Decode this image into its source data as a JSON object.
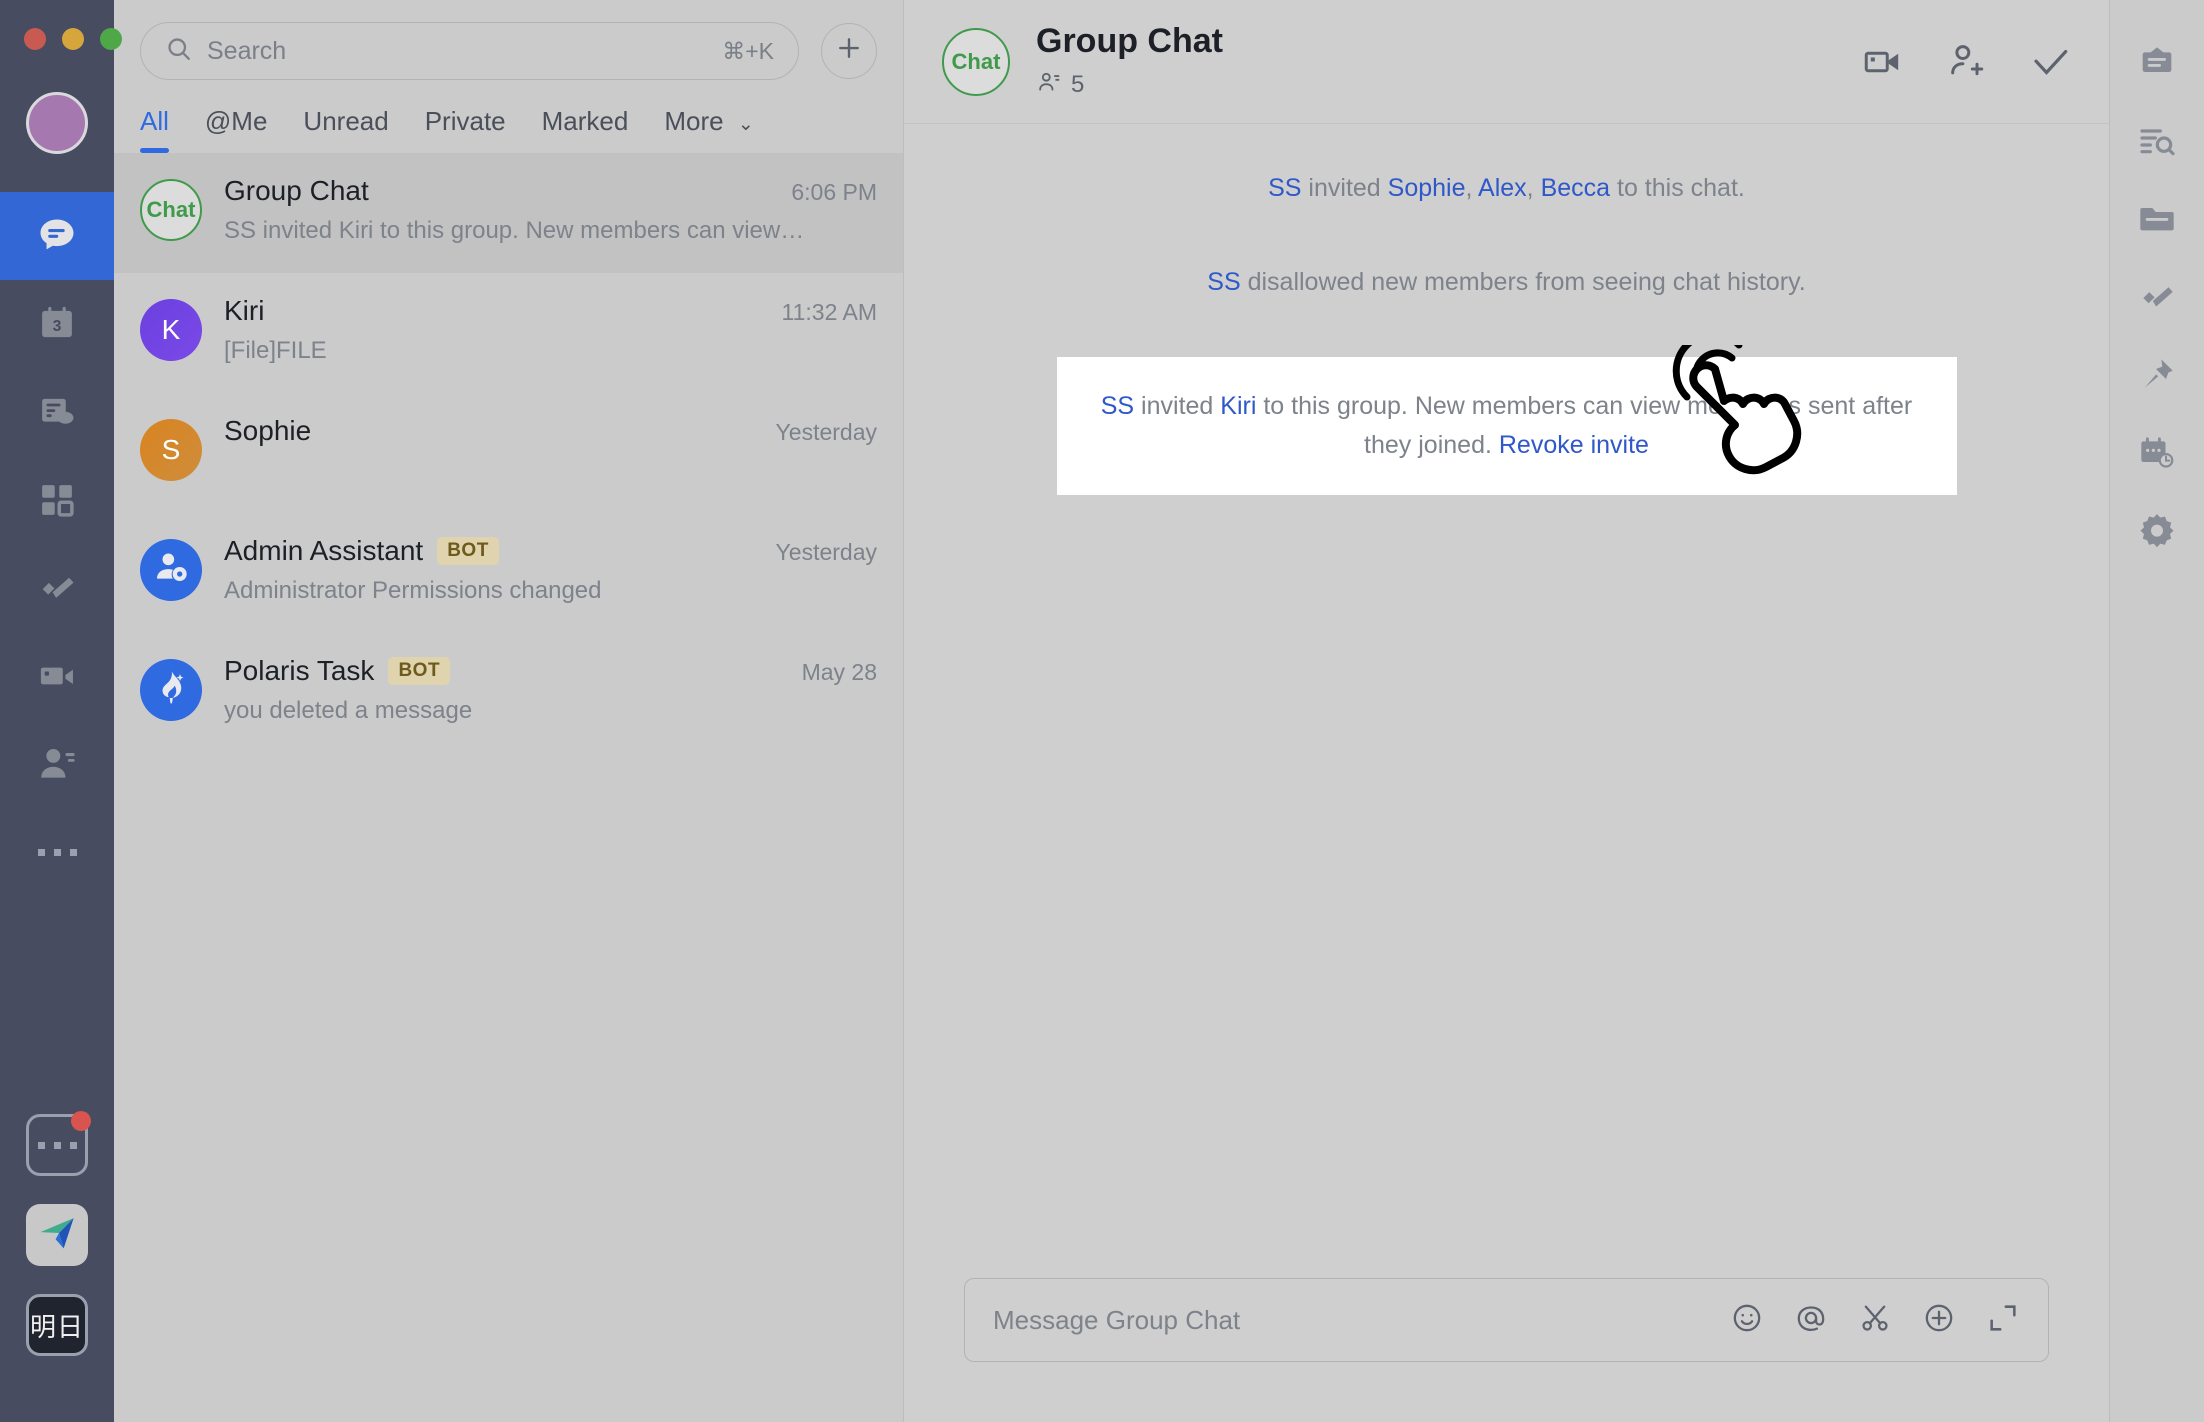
{
  "window": {
    "traffic_lights": [
      "close",
      "minimize",
      "maximize"
    ]
  },
  "left_rail": {
    "avatar_label": "",
    "items": [
      {
        "name": "chat",
        "icon": "chat-bubble-icon",
        "active": true
      },
      {
        "name": "calendar",
        "icon": "calendar-3-icon",
        "badge": "3",
        "active": false
      },
      {
        "name": "docs",
        "icon": "document-cloud-icon",
        "active": false
      },
      {
        "name": "workspace",
        "icon": "grid-apps-icon",
        "active": false
      },
      {
        "name": "tasks",
        "icon": "check-tasks-icon",
        "active": false
      },
      {
        "name": "meetings",
        "icon": "video-camera-icon",
        "active": false
      },
      {
        "name": "contacts",
        "icon": "contacts-icon",
        "active": false
      },
      {
        "name": "more",
        "icon": "ellipsis-icon",
        "active": false
      }
    ],
    "bottom": [
      {
        "name": "more-apps",
        "icon": "ellipsis-box-icon",
        "has_badge": true
      },
      {
        "name": "plane-app",
        "icon": "paper-plane-icon",
        "has_badge": false
      },
      {
        "name": "tomorrow-app",
        "icon": "kanji-icon",
        "label": "明日",
        "has_badge": false
      }
    ]
  },
  "search": {
    "placeholder": "Search",
    "shortcut": "⌘+K",
    "icon": "search-icon"
  },
  "new_chat_button": {
    "label": "+",
    "name": "new-chat-button"
  },
  "tabs": [
    {
      "label": "All",
      "active": true
    },
    {
      "label": "@Me",
      "active": false
    },
    {
      "label": "Unread",
      "active": false
    },
    {
      "label": "Private",
      "active": false
    },
    {
      "label": "Marked",
      "active": false
    },
    {
      "label": "More",
      "active": false,
      "chevron": "⌄"
    }
  ],
  "chat_list": [
    {
      "title": "Group Chat",
      "subtitle": "SS invited Kiri to this group. New members can view…",
      "time": "6:06 PM",
      "avatar_text": "Chat",
      "avatar_kind": "chat",
      "bot": false,
      "selected": true
    },
    {
      "title": "Kiri",
      "subtitle": "[File]FILE",
      "time": "11:32 AM",
      "avatar_text": "K",
      "avatar_kind": "kiri",
      "bot": false,
      "selected": false
    },
    {
      "title": "Sophie",
      "subtitle": "",
      "time": "Yesterday",
      "avatar_text": "S",
      "avatar_kind": "sophie",
      "bot": false,
      "selected": false
    },
    {
      "title": "Admin Assistant",
      "subtitle": "Administrator Permissions changed",
      "time": "Yesterday",
      "avatar_text": "",
      "avatar_kind": "bot-admin",
      "bot": true,
      "bot_label": "BOT",
      "selected": false
    },
    {
      "title": "Polaris Task",
      "subtitle": "you deleted a message",
      "time": "May 28",
      "avatar_text": "",
      "avatar_kind": "bot-polaris",
      "bot": true,
      "bot_label": "BOT",
      "selected": false
    }
  ],
  "chat_header": {
    "avatar_text": "Chat",
    "title": "Group Chat",
    "member_count": "5",
    "icons": [
      {
        "name": "video-call-icon"
      },
      {
        "name": "add-member-icon"
      },
      {
        "name": "check-icon"
      }
    ]
  },
  "messages": [
    {
      "type": "system",
      "parts": [
        {
          "text": "SS",
          "link": true
        },
        {
          "text": " invited ",
          "link": false
        },
        {
          "text": "Sophie",
          "link": true
        },
        {
          "text": ", ",
          "link": false
        },
        {
          "text": "Alex",
          "link": true
        },
        {
          "text": ", ",
          "link": false
        },
        {
          "text": "Becca",
          "link": true
        },
        {
          "text": " to this chat.",
          "link": false
        }
      ]
    },
    {
      "type": "system",
      "parts": [
        {
          "text": "SS",
          "link": true
        },
        {
          "text": " disallowed new members from seeing chat history.",
          "link": false
        }
      ]
    }
  ],
  "highlighted_card": {
    "actor": "SS",
    "text_1": " invited ",
    "invitee": "Kiri",
    "text_2": " to this group. New members can view messages sent after they joined. ",
    "action_label": "Revoke invite"
  },
  "composer": {
    "placeholder": "Message Group Chat",
    "icons": [
      {
        "name": "emoji-icon"
      },
      {
        "name": "mention-icon"
      },
      {
        "name": "scissors-icon"
      },
      {
        "name": "add-attachment-icon"
      },
      {
        "name": "expand-icon"
      }
    ]
  },
  "right_rail": [
    {
      "name": "pinned-board-icon"
    },
    {
      "name": "search-messages-icon"
    },
    {
      "name": "files-folder-icon"
    },
    {
      "name": "tasks-check-icon"
    },
    {
      "name": "pin-icon"
    },
    {
      "name": "schedule-icon"
    },
    {
      "name": "settings-gear-icon"
    }
  ],
  "colors": {
    "rail_bg": "#474c61",
    "accent_blue": "#2f6ae0",
    "link_blue": "#2f58c9",
    "list_bg": "#cbcbcb",
    "chat_bg": "#cfcfcf",
    "selected_row": "#c2c2c2",
    "bot_tag_bg": "#dfd4ae",
    "bot_tag_fg": "#6e5a1d",
    "chat_avatar_green": "#3f9a4a",
    "card_bg": "#ffffff"
  }
}
